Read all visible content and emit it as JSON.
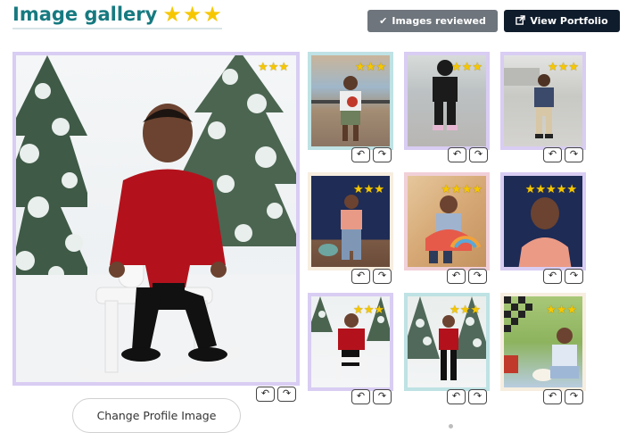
{
  "header": {
    "title": "Image gallery",
    "title_stars": [
      "★",
      "★",
      "★"
    ],
    "reviewed_label": "Images reviewed",
    "reviewed_icon": "check-icon",
    "portfolio_label": "View Portfolio",
    "portfolio_icon": "external-link-icon"
  },
  "main_image": {
    "stars": [
      "★",
      "★",
      "★"
    ],
    "subject": "child in red sweater on white rocking horse among snowy trees",
    "rotate_left_icon": "rotate-left-icon",
    "rotate_right_icon": "rotate-right-icon"
  },
  "thumbnails": [
    {
      "stars": [
        "★",
        "★",
        "★"
      ],
      "subject": "boy on boardwalk at sunset"
    },
    {
      "stars": [
        "★",
        "★",
        "★"
      ],
      "subject": "boy in black outfit on pavement"
    },
    {
      "stars": [
        "★",
        "★",
        "★"
      ],
      "subject": "boy in vest on street"
    },
    {
      "stars": [
        "★",
        "★",
        "★"
      ],
      "subject": "boy in pink shirt against navy wall"
    },
    {
      "stars": [
        "★",
        "★",
        "★",
        "★"
      ],
      "subject": "boy seated with rainbow toy"
    },
    {
      "stars": [
        "★",
        "★",
        "★",
        "★",
        "★"
      ],
      "subject": "boy in pink shirt close-up navy backdrop"
    },
    {
      "stars": [
        "★",
        "★",
        "★"
      ],
      "subject": "boy on rocking horse in snowy trees"
    },
    {
      "stars": [
        "★",
        "★",
        "★"
      ],
      "subject": "boy standing among snowy trees"
    },
    {
      "stars": [
        "★",
        "★",
        "★"
      ],
      "subject": "child with cake checkered backdrop"
    }
  ],
  "rotate_symbols": {
    "left": "↶",
    "right": "↷"
  },
  "actions": {
    "change_profile_label": "Change Profile Image"
  },
  "colors": {
    "title": "#167a80",
    "star": "#f6c700",
    "reviewed_button": "#6e757c",
    "portfolio_button": "#0f1c2c",
    "border_teal": "#bfe2e4",
    "border_lavender": "#d9cdf3",
    "border_pink": "#f1d0d8",
    "border_cream": "#f7eee0"
  }
}
